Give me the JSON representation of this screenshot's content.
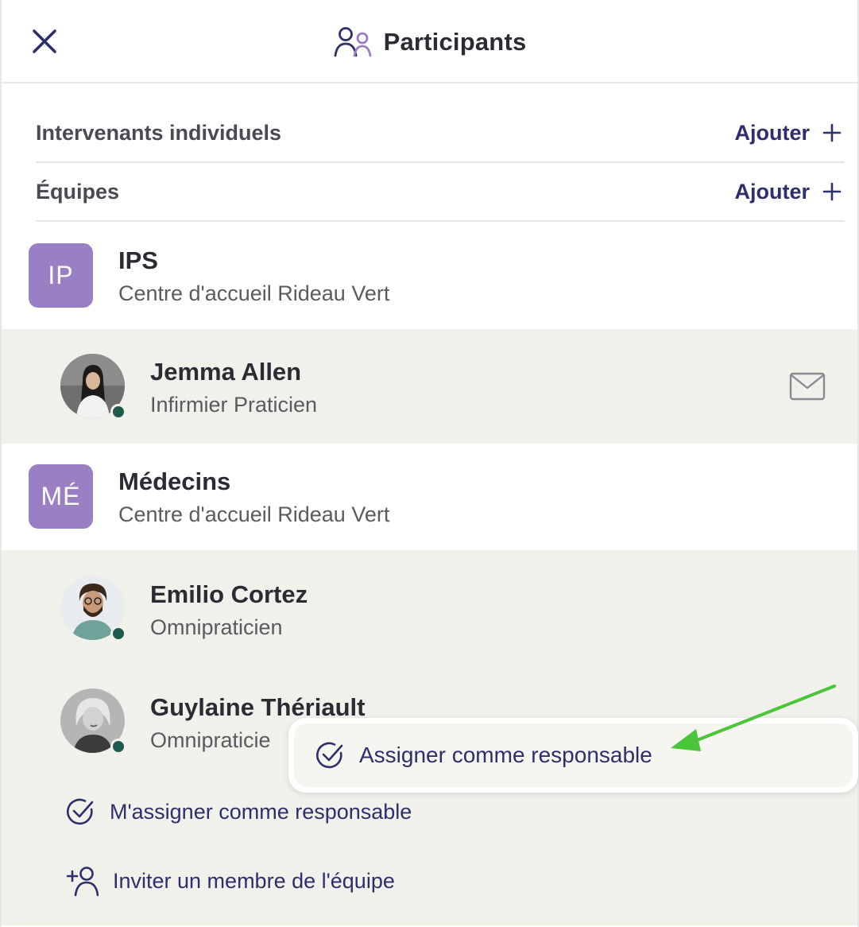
{
  "header": {
    "title": "Participants",
    "close_icon": "close-icon",
    "title_icon": "participants-icon"
  },
  "sections": {
    "individuals": {
      "label": "Intervenants individuels",
      "add_label": "Ajouter"
    },
    "teams": {
      "label": "Équipes",
      "add_label": "Ajouter"
    }
  },
  "teams": [
    {
      "initials": "IP",
      "name": "IPS",
      "subtitle": "Centre d'accueil Rideau Vert",
      "members": [
        {
          "name": "Jemma Allen",
          "role": "Infirmier Praticien",
          "online": true
        }
      ]
    },
    {
      "initials": "MÉ",
      "name": "Médecins",
      "subtitle": "Centre d'accueil Rideau Vert",
      "members": [
        {
          "name": "Emilio Cortez",
          "role": "Omnipraticien",
          "online": true
        },
        {
          "name": "Guylaine Thériault",
          "role": "Omnipraticie",
          "online": true
        }
      ]
    }
  ],
  "actions": {
    "assign_me": "M'assigner comme responsable",
    "invite": "Inviter un membre de l'équipe"
  },
  "popover": {
    "label": "Assigner comme responsable"
  },
  "colors": {
    "accent": "#2c2f6b",
    "badge": "#9b7fc5",
    "member_bg": "#f1f1ec",
    "online": "#1f5a4c",
    "arrow": "#4cc43a"
  }
}
